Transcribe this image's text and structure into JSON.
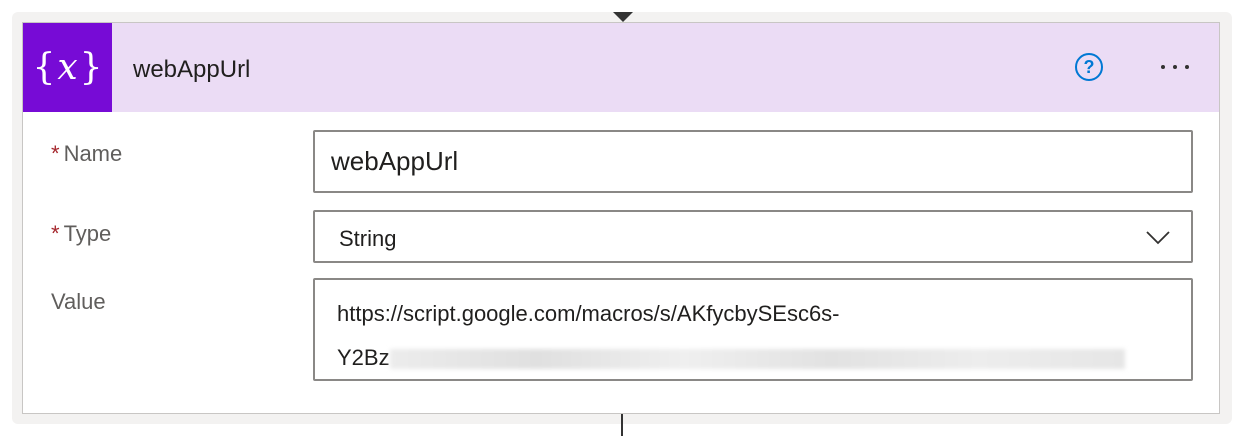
{
  "card": {
    "title": "webAppUrl",
    "icon": "variable-icon",
    "header_icon_open": "{",
    "header_icon_var": "x",
    "header_icon_close": "}",
    "help_glyph": "?",
    "accent_color": "#770bd6",
    "header_bg": "#ebdcf5"
  },
  "fields": {
    "name": {
      "label": "Name",
      "required_mark": "*",
      "value": "webAppUrl"
    },
    "type": {
      "label": "Type",
      "required_mark": "*",
      "value": "String"
    },
    "value": {
      "label": "Value",
      "line1": "https://script.google.com/macros/s/AKfycbySEsc6s-",
      "line2_visible": "Y2Bz"
    }
  }
}
